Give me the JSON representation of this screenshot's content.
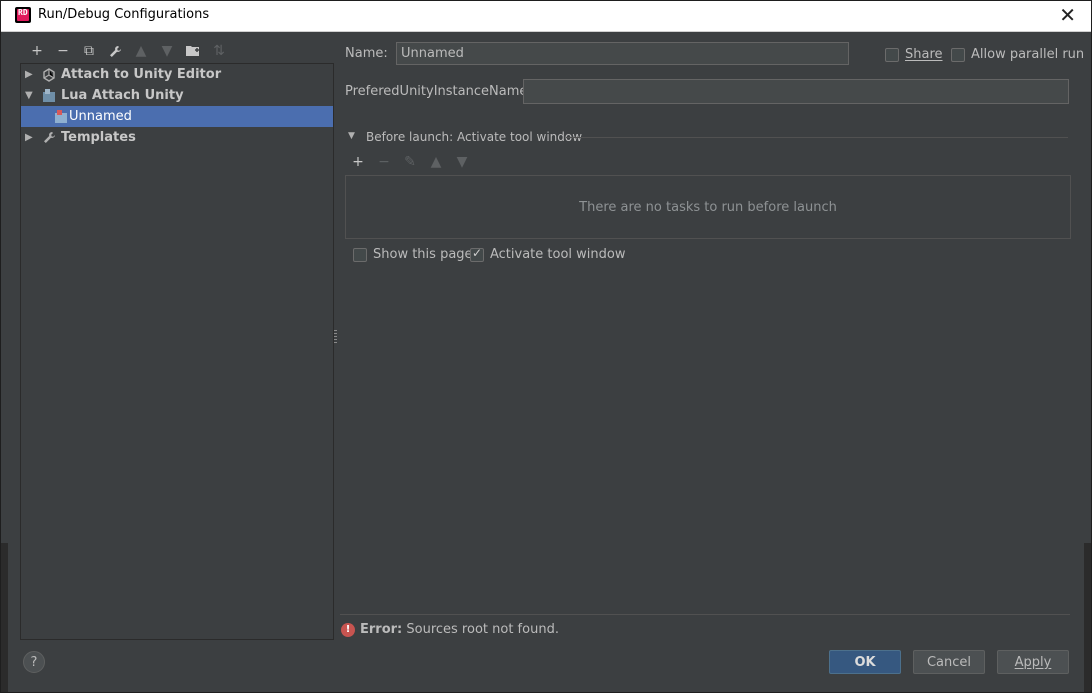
{
  "window": {
    "title": "Run/Debug Configurations",
    "app_icon_text": "RD"
  },
  "toolbar": {
    "buttons": [
      {
        "name": "add-icon",
        "glyph": "+"
      },
      {
        "name": "remove-icon",
        "glyph": "−"
      },
      {
        "name": "copy-icon",
        "glyph": "⧉"
      },
      {
        "name": "wrench-icon",
        "glyph": "🔧"
      },
      {
        "name": "move-up-icon",
        "glyph": "▲"
      },
      {
        "name": "move-down-icon",
        "glyph": "▼"
      },
      {
        "name": "folder-icon",
        "glyph": "▣"
      },
      {
        "name": "sort-icon",
        "glyph": "⇅"
      }
    ]
  },
  "tree": {
    "items": [
      {
        "label": "Attach to Unity Editor",
        "icon": "unity-icon",
        "arrow": "▶"
      },
      {
        "label": "Lua Attach Unity",
        "icon": "lua-unity-icon",
        "arrow": "▼"
      },
      {
        "label": "Unnamed",
        "icon": "config-icon",
        "arrow": ""
      },
      {
        "label": "Templates",
        "icon": "wrench-icon",
        "arrow": "▶"
      }
    ]
  },
  "form": {
    "name_label": "Name:",
    "name_value": "Unnamed",
    "share_label": "Share",
    "parallel_label": "Allow parallel run",
    "instance_label": "PreferedUnityInstanceName:",
    "instance_value": ""
  },
  "before_launch": {
    "title": "Before launch: Activate tool window",
    "empty_text": "There are no tasks to run before launch",
    "show_page_label": "Show this page",
    "activate_label": "Activate tool window"
  },
  "error": {
    "prefix": "Error:",
    "message": " Sources root not found."
  },
  "buttons": {
    "ok": "OK",
    "cancel": "Cancel",
    "apply": "Apply",
    "help": "?"
  },
  "colors": {
    "selection": "#4b6eaf",
    "error": "#c75450",
    "primary": "#365880"
  }
}
